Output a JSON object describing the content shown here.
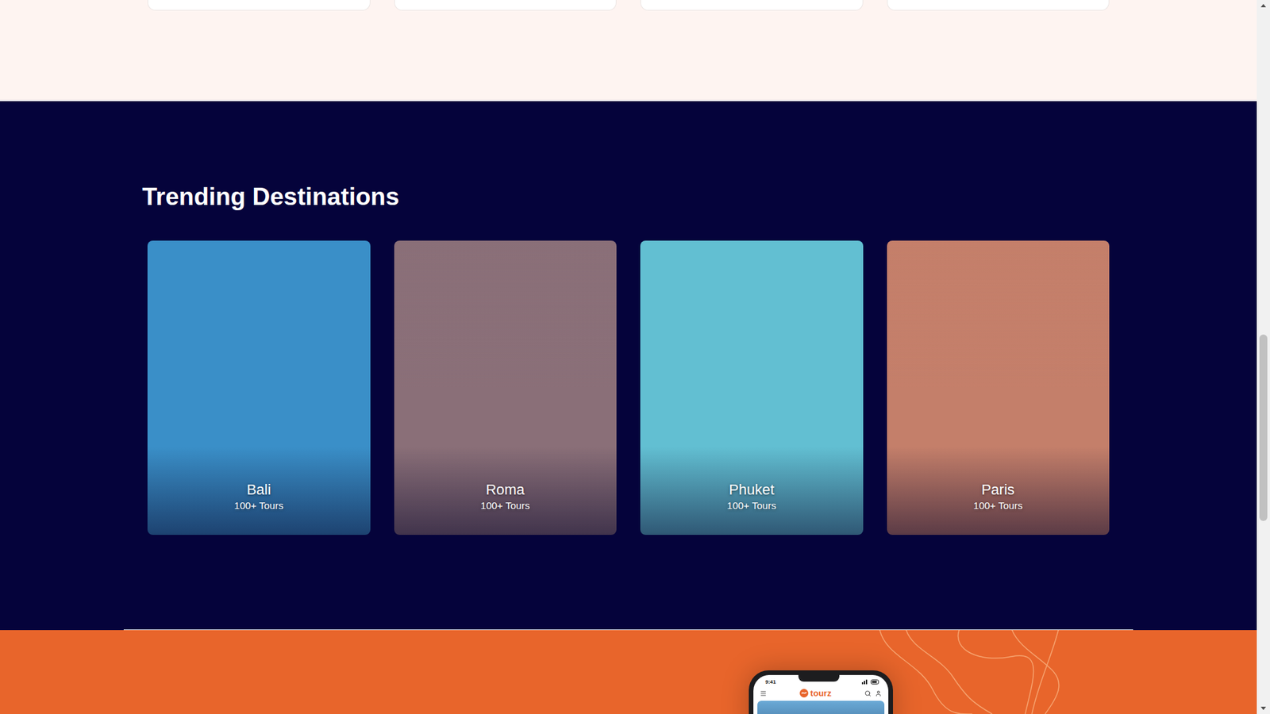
{
  "previous_section": {
    "cards": [
      {
        "cut_off": true
      },
      {
        "cut_off": true
      },
      {
        "cut_off": true
      },
      {
        "cut_off": true
      }
    ]
  },
  "trending": {
    "title": "Trending Destinations",
    "destinations": [
      {
        "name": "Bali",
        "tours": "100+ Tours",
        "color": "#3a8fc8"
      },
      {
        "name": "Roma",
        "tours": "100+ Tours",
        "color": "#8a6f78"
      },
      {
        "name": "Phuket",
        "tours": "100+ Tours",
        "color": "#62bfd2"
      },
      {
        "name": "Paris",
        "tours": "100+ Tours",
        "color": "#c47f6a"
      }
    ]
  },
  "app_promo": {
    "phone": {
      "time": "9:41",
      "brand": "tourz"
    }
  },
  "scrollbar": {
    "level": 0.64,
    "thumb": 0.27
  }
}
